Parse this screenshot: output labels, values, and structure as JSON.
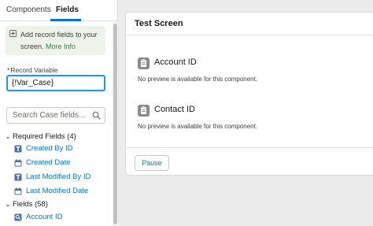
{
  "tabs": [
    {
      "label": "Components",
      "active": false
    },
    {
      "label": "Fields",
      "active": true
    }
  ],
  "info": {
    "text": "Add record fields to your screen.",
    "link": "More Info"
  },
  "record_variable": {
    "required_marker": "*",
    "label": "Record Variable",
    "value": "{!Var_Case}"
  },
  "search": {
    "placeholder": "Search Case fields..."
  },
  "required_group": {
    "label": "Required Fields (4)",
    "items": [
      "Created By ID",
      "Created Date",
      "Last Modified By ID",
      "Last Modified Date"
    ]
  },
  "fields_group": {
    "label": "Fields (58)",
    "items": [
      "Account ID"
    ]
  },
  "canvas": {
    "title": "Test Screen",
    "components": [
      {
        "title": "Account ID",
        "note": "No preview is available for this component."
      },
      {
        "title": "Contact ID",
        "note": "No preview is available for this component."
      }
    ],
    "pause_label": "Pause"
  },
  "colors": {
    "accent": "#0176d3",
    "info_bg": "#eef3ea",
    "link_green": "#2e844a",
    "focus_border": "#1b96ff"
  }
}
